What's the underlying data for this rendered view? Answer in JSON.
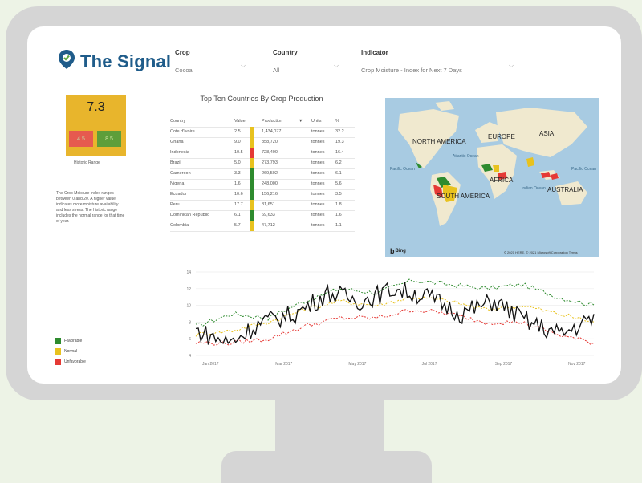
{
  "brand": {
    "name": "The Signal"
  },
  "filters": [
    {
      "label": "Crop",
      "value": "Cocoa"
    },
    {
      "label": "Country",
      "value": "All"
    },
    {
      "label": "Indicator",
      "value": "Crop Moisture - Index for Next 7 Days"
    }
  ],
  "kpi": {
    "value": "7.3",
    "low": "4.5",
    "high": "8.5",
    "range_label": "Historic Range"
  },
  "description": "The Crop Moisture Index ranges between 0 and 20. A higher value indicates more moisture availability and less stress. The historic range includes the normal range for that time of year.",
  "table": {
    "title": "Top Ten Countries By Crop Production",
    "headers": [
      "Country",
      "Value",
      "Production",
      "Units",
      "%"
    ],
    "rows": [
      {
        "country": "Cote d'Ivoire",
        "value": "2.5",
        "production": "1,434,077",
        "units": "tonnes",
        "pct": "32.2",
        "status": "normal"
      },
      {
        "country": "Ghana",
        "value": "9.0",
        "production": "858,720",
        "units": "tonnes",
        "pct": "19.3",
        "status": "normal"
      },
      {
        "country": "Indonesia",
        "value": "10.5",
        "production": "728,400",
        "units": "tonnes",
        "pct": "16.4",
        "status": "unfavorable"
      },
      {
        "country": "Brazil",
        "value": "5.0",
        "production": "273,793",
        "units": "tonnes",
        "pct": "6.2",
        "status": "normal"
      },
      {
        "country": "Cameroon",
        "value": "3.3",
        "production": "269,502",
        "units": "tonnes",
        "pct": "6.1",
        "status": "favorable"
      },
      {
        "country": "Nigeria",
        "value": "1.6",
        "production": "248,000",
        "units": "tonnes",
        "pct": "5.6",
        "status": "favorable"
      },
      {
        "country": "Ecuador",
        "value": "10.6",
        "production": "156,216",
        "units": "tonnes",
        "pct": "3.5",
        "status": "favorable"
      },
      {
        "country": "Peru",
        "value": "17.7",
        "production": "81,651",
        "units": "tonnes",
        "pct": "1.8",
        "status": "normal"
      },
      {
        "country": "Dominican Republic",
        "value": "6.1",
        "production": "69,633",
        "units": "tonnes",
        "pct": "1.6",
        "status": "favorable"
      },
      {
        "country": "Colombia",
        "value": "5.7",
        "production": "47,712",
        "units": "tonnes",
        "pct": "1.1",
        "status": "normal"
      }
    ]
  },
  "map": {
    "labels": [
      "NORTH AMERICA",
      "EUROPE",
      "ASIA",
      "AFRICA",
      "SOUTH AMERICA",
      "AUSTRALIA"
    ],
    "oceans": [
      "Pacific Ocean",
      "Atlantic Ocean",
      "Indian Ocean",
      "Pacific Ocean"
    ],
    "provider": "Bing",
    "copyright": "© 2021 HERE, © 2021 Microsoft Corporation Terms"
  },
  "legend": [
    {
      "label": "Favorable",
      "color": "#2e8b2e"
    },
    {
      "label": "Normal",
      "color": "#e8c21e"
    },
    {
      "label": "Unfavorable",
      "color": "#e53935"
    }
  ],
  "status_colors": {
    "favorable": "#2e8b2e",
    "normal": "#e8c21e",
    "unfavorable": "#e53935"
  },
  "chart_data": {
    "type": "line",
    "x": [
      "Jan 2017",
      "Mar 2017",
      "May 2017",
      "Jul 2017",
      "Sep 2017",
      "Nov 2017"
    ],
    "ylim": [
      4,
      14
    ],
    "yticks": [
      4,
      6,
      8,
      10,
      12,
      14
    ],
    "series": [
      {
        "values": [
          7.5,
          9.0,
          8.5,
          10.5,
          12.0,
          11.5,
          13.0,
          12.5,
          12.0,
          12.5,
          11.0,
          10.0
        ],
        "color": "#2e8b2e",
        "style": "dashed"
      },
      {
        "values": [
          6.5,
          7.0,
          8.0,
          9.5,
          10.5,
          10.0,
          11.0,
          10.5,
          9.5,
          10.0,
          9.0,
          8.0
        ],
        "color": "#e8c21e",
        "style": "dashed"
      },
      {
        "values": [
          5.5,
          5.5,
          6.0,
          7.5,
          8.5,
          8.5,
          9.5,
          9.0,
          8.0,
          8.0,
          6.5,
          5.5
        ],
        "color": "#e53935",
        "style": "dashed"
      },
      {
        "values": [
          7.0,
          5.5,
          8.0,
          9.0,
          11.5,
          10.5,
          12.0,
          11.0,
          9.0,
          10.5,
          8.0,
          6.5,
          8.5
        ],
        "color": "#111111",
        "style": "solid"
      }
    ]
  }
}
